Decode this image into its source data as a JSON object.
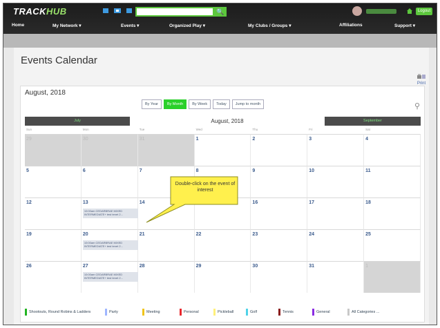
{
  "brand": {
    "part1": "TRACK",
    "part2": "HUB"
  },
  "topnav": [
    "Home",
    "My Network ▾",
    "Events ▾",
    "Organized Play ▾",
    "My Clubs / Groups ▾",
    "Affiliations",
    "Support ▾"
  ],
  "user": {
    "logout": "Logout"
  },
  "page": {
    "title": "Events Calendar",
    "print": "Print"
  },
  "calendar": {
    "heading": "August, 2018",
    "views": [
      {
        "label": "By Year",
        "active": false
      },
      {
        "label": "By Month",
        "active": true
      },
      {
        "label": "By Week",
        "active": false
      },
      {
        "label": "Today",
        "active": false
      },
      {
        "label": "Jump to month",
        "active": false
      }
    ],
    "prev_month": "July",
    "current_month": "August, 2018",
    "next_month": "September",
    "dow": [
      "Sun",
      "Mon",
      "Tue",
      "Wed",
      "Thu",
      "Fri",
      "Sat"
    ],
    "weeks": [
      [
        {
          "d": "29",
          "out": true
        },
        {
          "d": "30",
          "out": true
        },
        {
          "d": "31",
          "out": true
        },
        {
          "d": "1"
        },
        {
          "d": "2"
        },
        {
          "d": "3"
        },
        {
          "d": "4"
        }
      ],
      [
        {
          "d": "5"
        },
        {
          "d": "6"
        },
        {
          "d": "7"
        },
        {
          "d": "8"
        },
        {
          "d": "9"
        },
        {
          "d": "10"
        },
        {
          "d": "11"
        }
      ],
      [
        {
          "d": "12"
        },
        {
          "d": "13",
          "event": "10:00am CEDARBRAE MIXED INTERMEDIATE+ test tenet 2..."
        },
        {
          "d": "14"
        },
        {
          "d": "15"
        },
        {
          "d": "16"
        },
        {
          "d": "17"
        },
        {
          "d": "18"
        }
      ],
      [
        {
          "d": "19"
        },
        {
          "d": "20",
          "event": "10:00am CEDARBRAE MIXED INTERMEDIATE+ test tenet 2..."
        },
        {
          "d": "21"
        },
        {
          "d": "22"
        },
        {
          "d": "23"
        },
        {
          "d": "24"
        },
        {
          "d": "25"
        }
      ],
      [
        {
          "d": "26"
        },
        {
          "d": "27",
          "event": "10:00am CEDARBRAE MIXED INTERMEDIATE+ test tenet 2..."
        },
        {
          "d": "28"
        },
        {
          "d": "29"
        },
        {
          "d": "30"
        },
        {
          "d": "31"
        },
        {
          "d": "1",
          "out": true
        }
      ]
    ]
  },
  "legend": [
    {
      "label": "Shootouts, Round Robins & Ladders",
      "color": "#22b422"
    },
    {
      "label": "Party",
      "color": "#9fb6ff"
    },
    {
      "label": "Meeting",
      "color": "#f0c419"
    },
    {
      "label": "Personal",
      "color": "#e8282d"
    },
    {
      "label": "Pickleball",
      "color": "#fff07a"
    },
    {
      "label": "Golf",
      "color": "#4fd2e8"
    },
    {
      "label": "Tennis",
      "color": "#8a1c1c"
    },
    {
      "label": "General",
      "color": "#8a2be2"
    },
    {
      "label": "All Categories ...",
      "color": "#c8c8c8"
    }
  ],
  "callout": {
    "text": "Double-click on the event of interest"
  }
}
